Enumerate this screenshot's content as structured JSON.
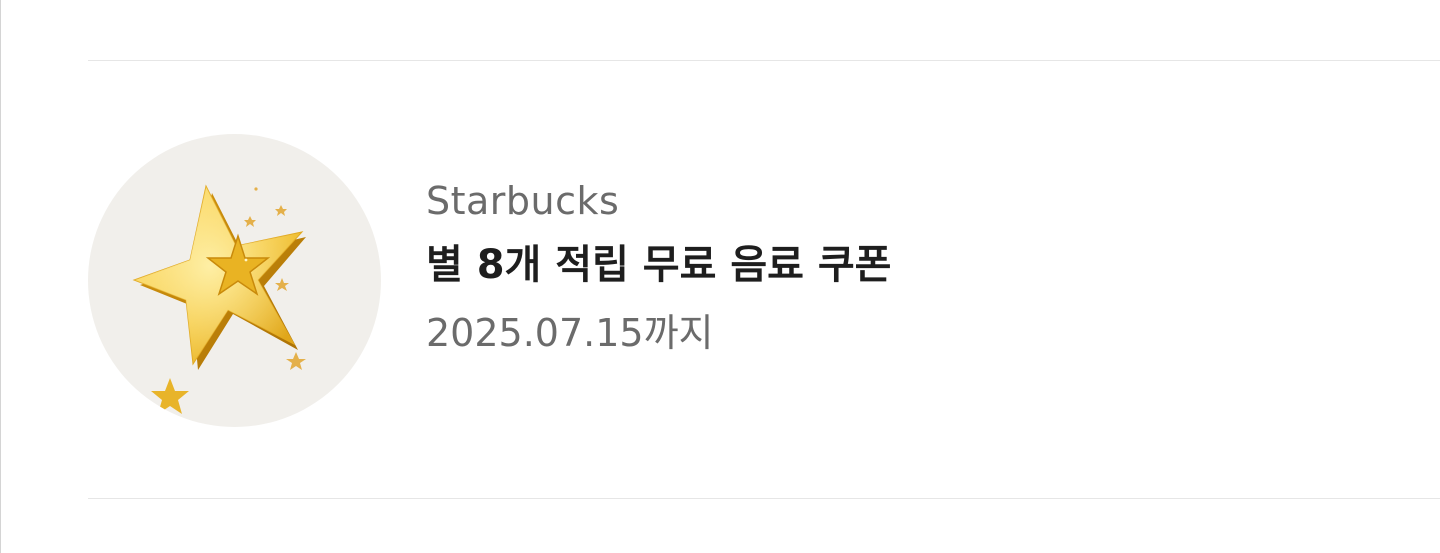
{
  "coupon": {
    "brand": "Starbucks",
    "title": "별 8개 적립 무료 음료 쿠폰",
    "expiry": "2025.07.15까지",
    "icon": "gold-star-icon"
  },
  "colors": {
    "thumb_background": "#f1efeb",
    "star_gold": "#f2c230",
    "brand_text": "#6b6b6b",
    "title_text": "#1e1e1e"
  }
}
